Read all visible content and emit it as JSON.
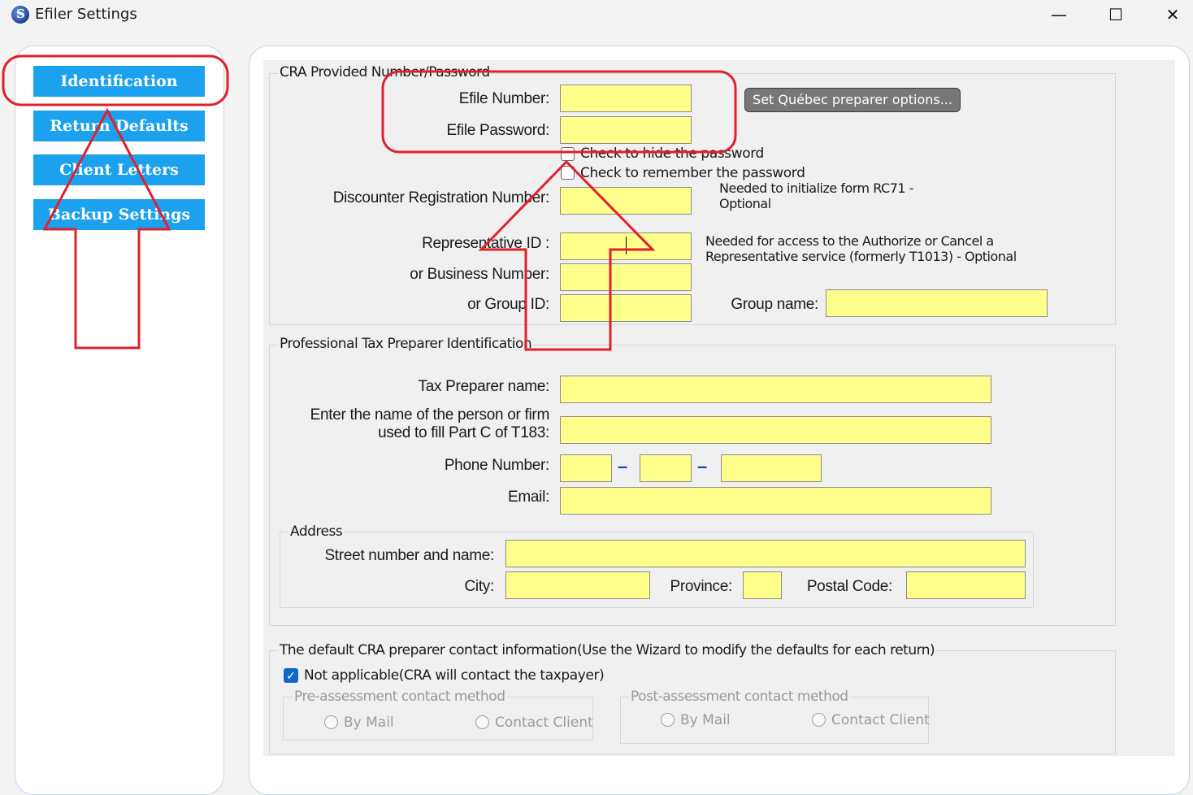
{
  "window": {
    "title": "Efiler Settings",
    "minimize": "—",
    "maximize": "☐",
    "close": "✕",
    "app_icon": "app-logo-icon"
  },
  "nav": [
    {
      "label": "Identification"
    },
    {
      "label": "Return Defaults"
    },
    {
      "label": "Client Letters"
    },
    {
      "label": "Backup Settings"
    }
  ],
  "cra": {
    "group_label": "CRA Provided Number/Password",
    "efile_number_label": "Efile Number:",
    "efile_password_label": "Efile Password:",
    "efile_number_value": "",
    "efile_password_value": "",
    "quebec_button": "Set Québec preparer options...",
    "hide_password_label": "Check to hide the password",
    "remember_password_label": "Check to remember the password",
    "discounter_label": "Discounter Registration Number:",
    "discounter_note_1": "Needed to initialize form RC71 -",
    "discounter_note_2": "Optional",
    "rep_id_label": "Representative ID :",
    "rep_note_1": "Needed for access to the Authorize or Cancel a",
    "rep_note_2": "Representative service (formerly T1013) - Optional",
    "business_number_label": "or Business Number:",
    "group_id_label": "or Group ID:",
    "group_name_label": "Group name:"
  },
  "preparer": {
    "group_label": "Professional Tax Preparer Identification",
    "name_label": "Tax Preparer name:",
    "partc_label_1": "Enter the name of the person or firm",
    "partc_label_2": "used to fill Part C of T183:",
    "phone_label": "Phone Number:",
    "phone_sep": "–",
    "email_label": "Email:",
    "address": {
      "group_label": "Address",
      "street_label": "Street number and name:",
      "city_label": "City:",
      "province_label": "Province:",
      "postal_label": "Postal Code:"
    }
  },
  "contact": {
    "group_label": "The default CRA preparer contact information(Use the Wizard to modify the defaults for each return)",
    "not_applicable_label": "Not applicable(CRA will contact the taxpayer)",
    "not_applicable_checked": true,
    "pre_label": "Pre-assessment contact method",
    "post_label": "Post-assessment contact method",
    "by_mail": "By Mail",
    "contact_client": "Contact Client"
  },
  "colors": {
    "nav_button": "#1ba1ee",
    "input_fill": "#ffff8c",
    "annotation_red": "#e0202a"
  }
}
